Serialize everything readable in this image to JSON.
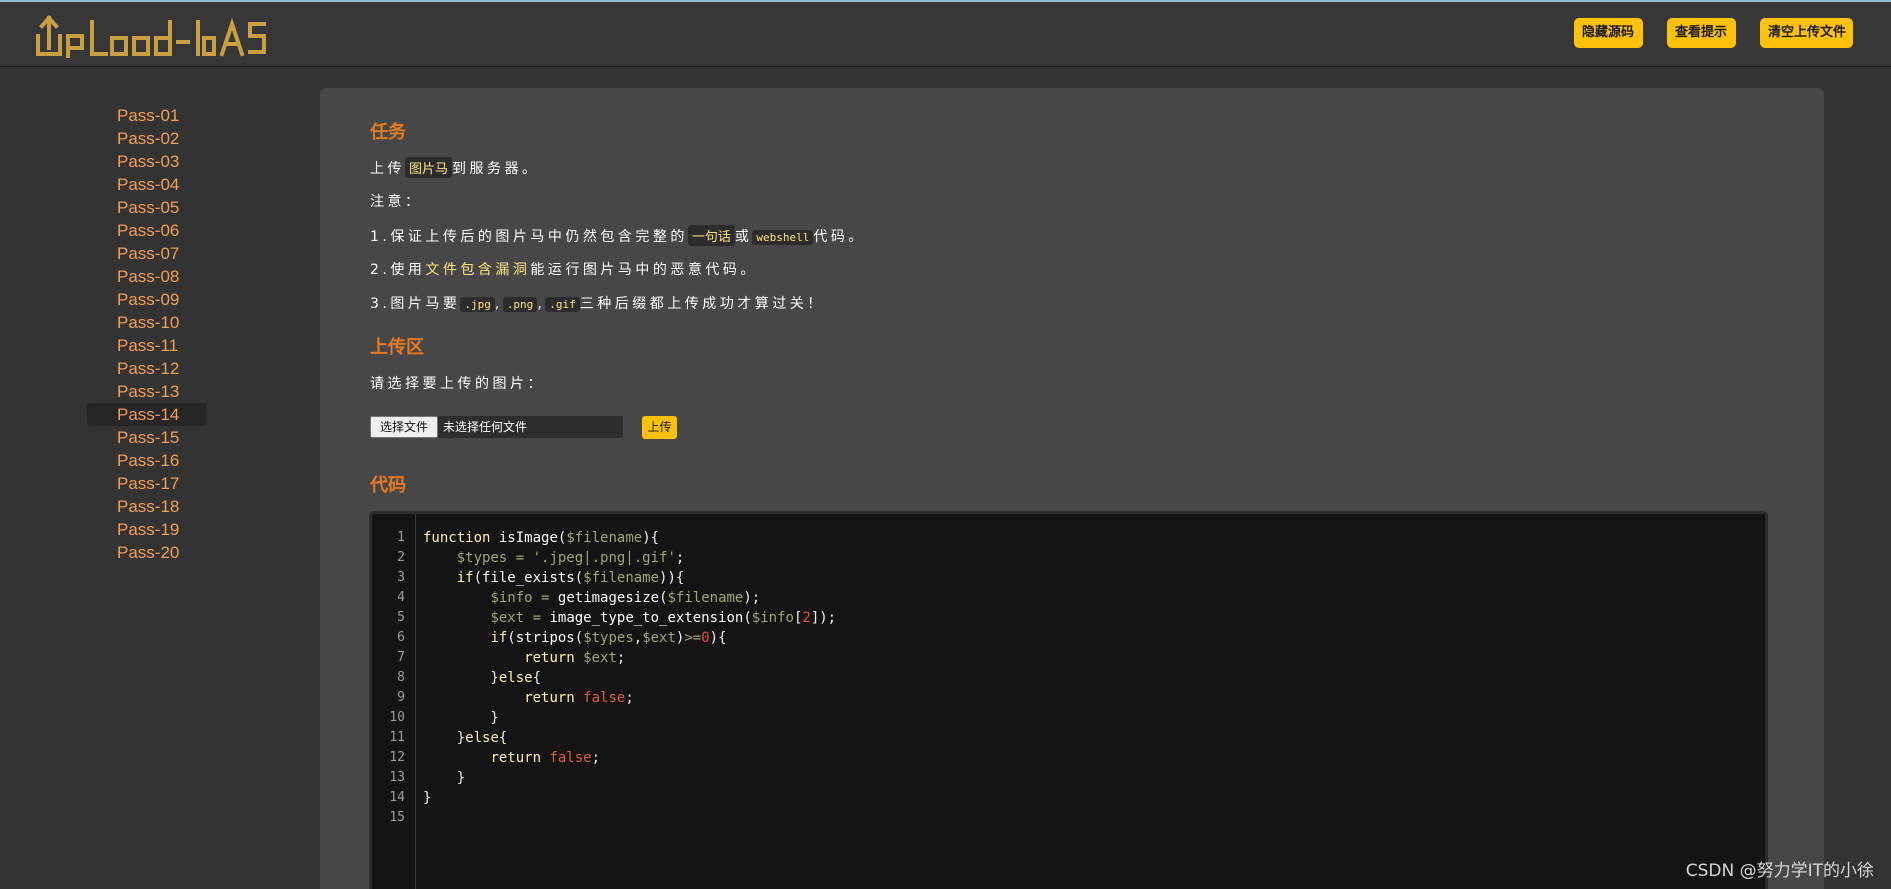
{
  "header": {
    "logo_text": "Upload-labs",
    "buttons": [
      "隐藏源码",
      "查看提示",
      "清空上传文件"
    ]
  },
  "sidebar": {
    "items": [
      "Pass-01",
      "Pass-02",
      "Pass-03",
      "Pass-04",
      "Pass-05",
      "Pass-06",
      "Pass-07",
      "Pass-08",
      "Pass-09",
      "Pass-10",
      "Pass-11",
      "Pass-12",
      "Pass-13",
      "Pass-14",
      "Pass-15",
      "Pass-16",
      "Pass-17",
      "Pass-18",
      "Pass-19",
      "Pass-20"
    ],
    "active": "Pass-14"
  },
  "task": {
    "title": "任务",
    "line1": [
      "上传",
      "图片马",
      "到服务器。"
    ],
    "note": "注意：",
    "item1": [
      "1.保证上传后的图片马中仍然包含完整的",
      "一句话",
      "或",
      "webshell",
      "代码。"
    ],
    "item2": [
      "2.使用",
      "文件包含漏洞",
      "能运行图片马中的恶意代码。"
    ],
    "item3": [
      "3.图片马要",
      ".jpg",
      ",",
      ".png",
      ",",
      ".gif",
      "三种后缀都上传成功才算过关！"
    ]
  },
  "upload": {
    "title": "上传区",
    "prompt": "请选择要上传的图片：",
    "choose_file": "选择文件",
    "file_status": "未选择任何文件",
    "submit": "上传"
  },
  "code": {
    "title": "代码",
    "line_numbers": [
      "1",
      "2",
      "3",
      "4",
      "5",
      "6",
      "7",
      "8",
      "9",
      "10",
      "11",
      "12",
      "13",
      "14",
      "15"
    ]
  },
  "watermark": "CSDN @努力学IT的小徐",
  "colors": {
    "accent": "#ffc107",
    "section_title": "#e8791e",
    "nav_link": "#f0a050",
    "background": "#333333",
    "card": "#474747"
  }
}
